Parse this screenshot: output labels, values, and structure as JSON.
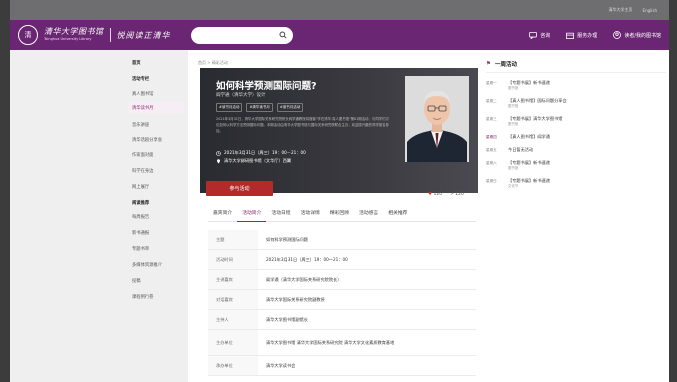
{
  "topbar": {
    "links": [
      "清华大学主页",
      "English"
    ]
  },
  "header": {
    "seal": "清",
    "logo_cn": "清华大学图书馆",
    "logo_en": "Tsinghua University Library",
    "slogan": "悦阅读正清华",
    "nav": [
      "咨询",
      "服务办理",
      "读者/我的图书馆"
    ]
  },
  "sidebar": {
    "sections": [
      {
        "title": "首页",
        "items": []
      },
      {
        "title": "活动专栏",
        "items": [
          "真人图书馆",
          "清华读书月",
          "音乐讲座",
          "清华话剧分享会",
          "作家面对面",
          "科学在身边",
          "网上展厅"
        ]
      },
      {
        "title": "阅读推荐",
        "items": [
          "每周报告",
          "新书通报",
          "专题书单",
          "多媒体资源推介",
          "投稿",
          "课程例行卷"
        ]
      }
    ],
    "active": "清华读书月"
  },
  "breadcrumb": "首页 > 精彩活动",
  "banner": {
    "title": "如何科学预测国际问题?",
    "subtitle": "阎学通（清华大学）设计",
    "tags": [
      "#读书月活动",
      "#清华读书月",
      "#读书月活动"
    ],
    "description": "2021年3月31日，清华大学国际关系研究院院长阎学通教授将做客\"学在清华·真人图书馆\"第81期活动，与同学们讨论如何以科学方法预测国际问题。本期活动由清华大学图书馆与国际关系研究院联合主办，欢迎感兴趣的同学报名参加。",
    "time": "2021年3月31日（周三）19：00－21：00",
    "place": "清华大学邺研图书馆（文华厅）西翼"
  },
  "join_label": "参与活动",
  "stats": {
    "likes": "120",
    "shares": "120"
  },
  "tabs": [
    "嘉宾简介",
    "活动简介",
    "活动日程",
    "活动详情",
    "精彩回顾",
    "活动感言",
    "相关推荐"
  ],
  "active_tab": "活动简介",
  "details": [
    {
      "k": "主题",
      "v": "如何科学预测国际问题"
    },
    {
      "k": "活动时间",
      "v": "2021年3月31日（周三）19：00～21：00"
    },
    {
      "k": "主讲嘉宾",
      "v": "阎学通（清华大学国际关系研究院院长）"
    },
    {
      "k": "对话嘉宾",
      "v": "清华大学国际关系研究院副教授"
    },
    {
      "k": "主持人",
      "v": "清华大学图书馆副馆长"
    },
    {
      "k": "主办单位",
      "v": "清华大学图书馆 清华大学国际关系研究院 清华大学文化素质教育基地"
    },
    {
      "k": "承办单位",
      "v": "清华大学读书会"
    }
  ],
  "right": {
    "title": "一周活动",
    "items": [
      {
        "d": "星期一",
        "t": "【专题书展】新书速递",
        "p": "图书馆"
      },
      {
        "d": "星期二",
        "t": "【真人图书馆】国际问题分享会",
        "p": "图书馆"
      },
      {
        "d": "星期三",
        "t": "【专题书展】清华大学图书馆",
        "p": "图书馆"
      },
      {
        "d": "星期四",
        "t": "【真人图书馆】阎学通",
        "p": ""
      },
      {
        "d": "星期五",
        "t": "今日暂无活动",
        "p": ""
      },
      {
        "d": "星期六",
        "t": "【专题书展】新书速递",
        "p": "图书馆"
      },
      {
        "d": "星期日",
        "t": "【专题书展】新书速递",
        "p": "文化节"
      }
    ],
    "active": "星期四"
  }
}
